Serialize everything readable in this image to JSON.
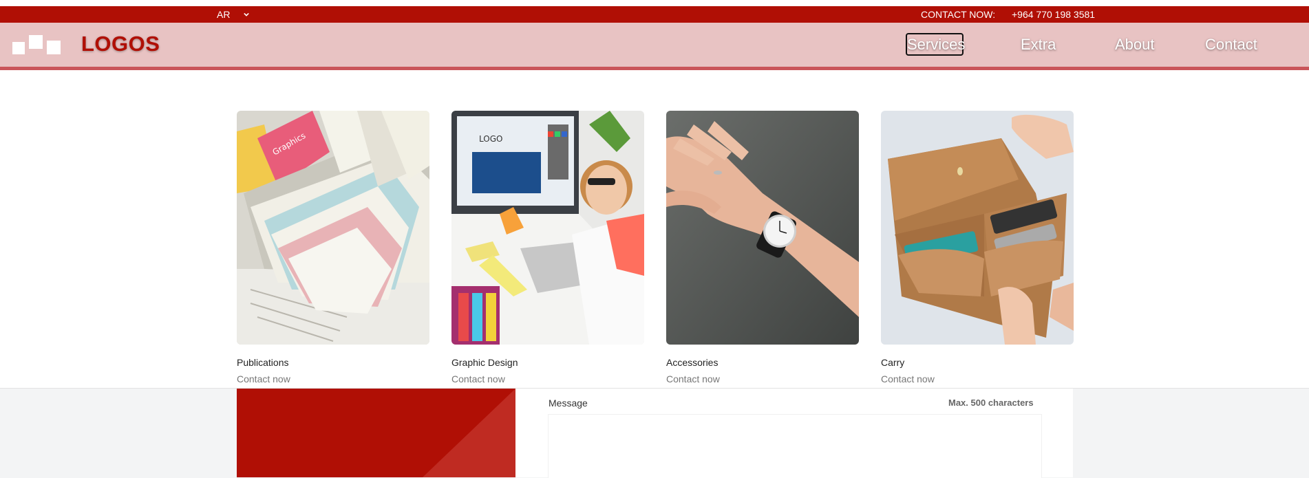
{
  "topbar": {
    "language": "AR",
    "contact_label": "CONTACT NOW:",
    "contact_phone": "+964 770 198 3581"
  },
  "header": {
    "logo_text": "LOGOS",
    "nav": [
      {
        "label": "Services"
      },
      {
        "label": "Extra"
      },
      {
        "label": "About"
      },
      {
        "label": "Contact"
      }
    ]
  },
  "products": [
    {
      "title": "Publications",
      "cta": "Contact now",
      "icon": "publications-image"
    },
    {
      "title": "Graphic Design",
      "cta": "Contact now",
      "icon": "graphic-design-image"
    },
    {
      "title": "Accessories",
      "cta": "Contact now",
      "icon": "accessories-image"
    },
    {
      "title": "Carry",
      "cta": "Contact now",
      "icon": "carry-image"
    }
  ],
  "form": {
    "message_label": "Message",
    "max_label": "Max. 500 characters"
  },
  "colors": {
    "brand_red": "#b00f05",
    "nav_bg": "#e8c3c3"
  }
}
